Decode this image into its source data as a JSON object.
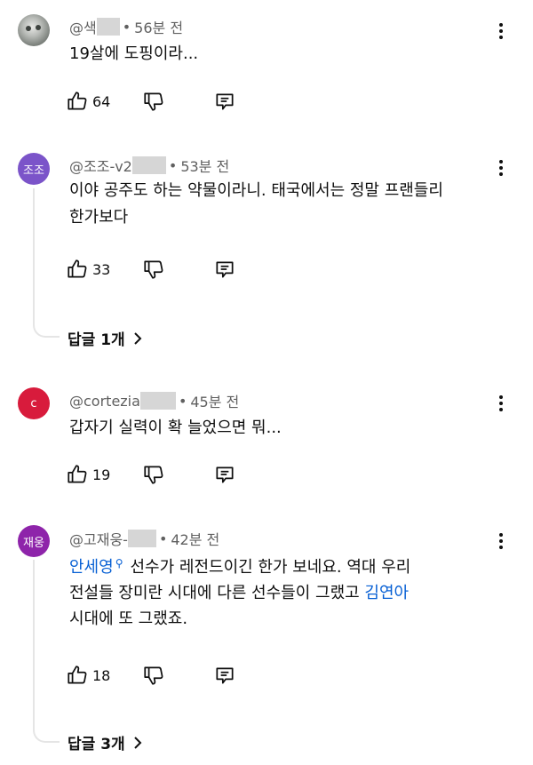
{
  "comments": [
    {
      "author": "@색",
      "time": "56분 전",
      "avatar_text": "",
      "avatar_color": "#8d928c",
      "text": "19살에 도핑이라...",
      "likes": "64"
    },
    {
      "author": "@조조-v2",
      "time": "53분 전",
      "avatar_text": "조조",
      "avatar_color": "#7b54c9",
      "text_line1": "이야 공주도 하는 약물이라니. 태국에서는 정말 프랜들리",
      "text_line2": "한가보다",
      "likes": "33",
      "replies": "답글 1개"
    },
    {
      "author": "@cortezia",
      "time": "45분 전",
      "avatar_text": "c",
      "avatar_color": "#d81b3c",
      "text": "갑자기 실력이 확 늘었으면 뭐...",
      "likes": "19"
    },
    {
      "author": "@고재웅-",
      "time": "42분 전",
      "avatar_text": "재웅",
      "avatar_color": "#8e24aa",
      "link1": "안세영",
      "text_a": "선수가 레전드이긴 한가 보네요. 역대 우리",
      "text_b": "전설들 장미란 시대에 다른 선수들이 그랬고",
      "link2": "김연아",
      "text_c": "시대에 또 그랬죠.",
      "likes": "18",
      "replies": "답글 3개"
    }
  ],
  "meta_separator": "•",
  "icons": {
    "like": "thumb-up-icon",
    "dislike": "thumb-down-icon",
    "reply": "reply-comment-icon",
    "more": "more-vert-icon",
    "link_search": "search-icon",
    "replies_chevron": "chevron-right-icon"
  },
  "colors": {
    "link": "#065fd4",
    "secondary_text": "#606060",
    "primary_text": "#0f0f0f",
    "thread_line": "#e5e5e5"
  }
}
